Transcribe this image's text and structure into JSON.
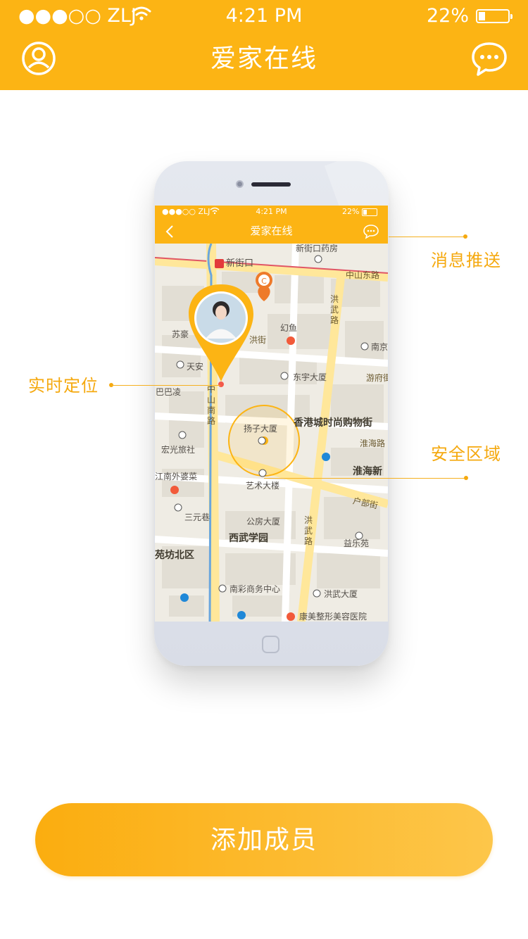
{
  "status_bar": {
    "carrier": "●●●○○ ZLJ",
    "time": "4:21 PM",
    "battery": "22%",
    "battery_level": 0.22
  },
  "nav": {
    "title": "爱家在线",
    "left_icon": "user-profile-icon",
    "right_icon": "chat-bubble-icon"
  },
  "phone_mockup": {
    "status_bar": {
      "carrier": "●●●○○ ZLJ",
      "time": "4:21 PM",
      "battery": "22%"
    },
    "title": "爱家在线",
    "map_labels": {
      "xinjiekou_pharmacy": "新街口药房",
      "xinjiekou": "新街口",
      "zhongshan_east_road": "中山东路",
      "hongwu_road_top": "洪武路",
      "suhao": "苏豪",
      "huanyu": "幻鱼",
      "hongjie": "洪街",
      "nanjing": "南京",
      "tianan": "天安",
      "dongyu_building": "东宇大厦",
      "youfu_road": "游府街",
      "babaling": "巴巴凌",
      "zhongshan_south_road": "中山南路",
      "yangzi_building": "扬子大厦",
      "hk_city_mall": "香港城时尚购物街",
      "huaihai_road": "淮海路",
      "hongguang_hotel": "宏光旅社",
      "huaihai_new": "淮海新",
      "jiangnan_restaurant": "江南外婆菜",
      "art_building": "艺术大楼",
      "hubu_street": "户部街",
      "sanyuan_lane": "三元巷",
      "public_housing": "公房大厦",
      "hongwu_road_bottom": "洪武路",
      "yile_yuan": "益乐苑",
      "xiwu_academy": "西武学园",
      "yuanfang_north": "苑坊北区",
      "nancai_center": "南彩商务中心",
      "hongwu_building": "洪武大厦",
      "kangmei_hospital": "康美整形美容医院"
    }
  },
  "callouts": {
    "message_push": "消息推送",
    "realtime_location": "实时定位",
    "safe_zone": "安全区域"
  },
  "actions": {
    "add_member": "添加成员"
  },
  "colors": {
    "brand": "#fcb414",
    "accent_text": "#f5a90f",
    "button_start": "#fbad0f",
    "button_end": "#fdc64a"
  }
}
